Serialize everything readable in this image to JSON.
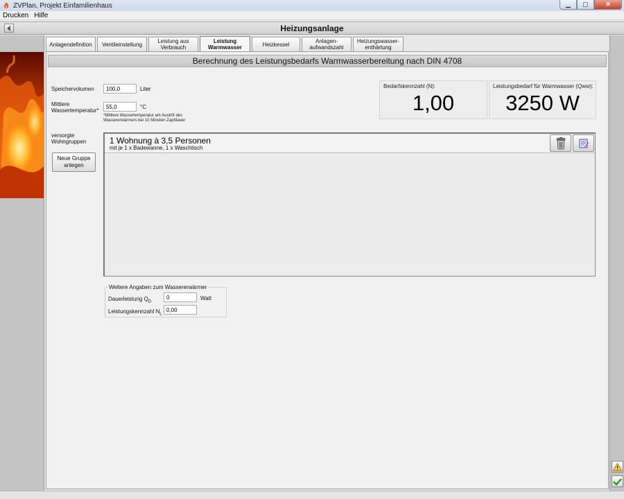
{
  "window": {
    "title": "ZVPlan, Projekt Einfamilienhaus"
  },
  "menu": [
    "Drucken",
    "Hilfe"
  ],
  "header": {
    "title": "Heizungsanlage"
  },
  "tabs": [
    {
      "label": "Anlagendefinition"
    },
    {
      "label": "Ventileinstellung"
    },
    {
      "label": "Leistung aus Verbrauch"
    },
    {
      "label": "Leistung Warmwasser",
      "active": true
    },
    {
      "label": "Heizkessel"
    },
    {
      "label": "Anlagen-aufwandszahl"
    },
    {
      "label": "Heizungswasser-enthärtung"
    }
  ],
  "section": {
    "title": "Berechnung des Leistungsbedarfs Warmwasserbereitung nach DIN 4708"
  },
  "form": {
    "speicher_label": "Speichervolumen",
    "speicher_value": "100,0",
    "speicher_unit": "Liter",
    "temp_label_1": "Mittlere",
    "temp_label_2": "Wassertemperatur*",
    "temp_value": "55,0",
    "temp_unit": "°C",
    "temp_note_1": "*Mittlere Wassertemperatur am Austritt des",
    "temp_note_2": "Wassererwärmers bei 10 Minuten Zapfdauer",
    "groups_label_1": "versorgte",
    "groups_label_2": "Wohngruppen",
    "new_group_1": "Neue Gruppe",
    "new_group_2": "anlegen"
  },
  "results": {
    "bedarf_label": "Bedarfskennzahl (N):",
    "bedarf_value": "1,00",
    "leistung_label": "Leistungsbedarf für Warmwasser (Qww):",
    "leistung_value": "3250 W"
  },
  "groups": [
    {
      "title": "1 Wohnung à 3,5 Personen",
      "subtitle": "mit je 1 x Badewanne, 1 x Waschtisch"
    }
  ],
  "weitere": {
    "legend": "Weitere Angaben zum Wassererwärmer",
    "dauer_label": "Dauerleistung Q",
    "dauer_sub": "D",
    "dauer_value": "0",
    "dauer_unit": "Watt",
    "kenn_label": "Leistungskennzahl N",
    "kenn_sub": "L",
    "kenn_value": "0,00"
  },
  "colors": {
    "header_bg": "#d4d4d4",
    "content_bg": "#f1f1f1",
    "side_bg": "#c4c4c4"
  }
}
